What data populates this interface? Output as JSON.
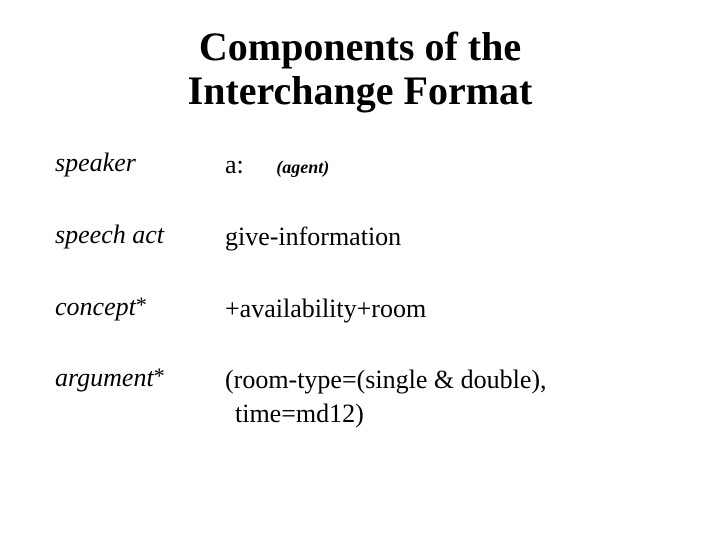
{
  "title_line1": "Components of the",
  "title_line2": "Interchange Format",
  "rows": {
    "speaker": {
      "label": "speaker",
      "value": "a:",
      "note": "(agent)"
    },
    "speech_act": {
      "label": "speech act",
      "value": "give-information"
    },
    "concept": {
      "label": "concept",
      "star": "*",
      "value": "+availability+room"
    },
    "argument": {
      "label": "argument",
      "star": "*",
      "value_line1": "(room-type=(single & double),",
      "value_line2": " time=md12)"
    }
  }
}
